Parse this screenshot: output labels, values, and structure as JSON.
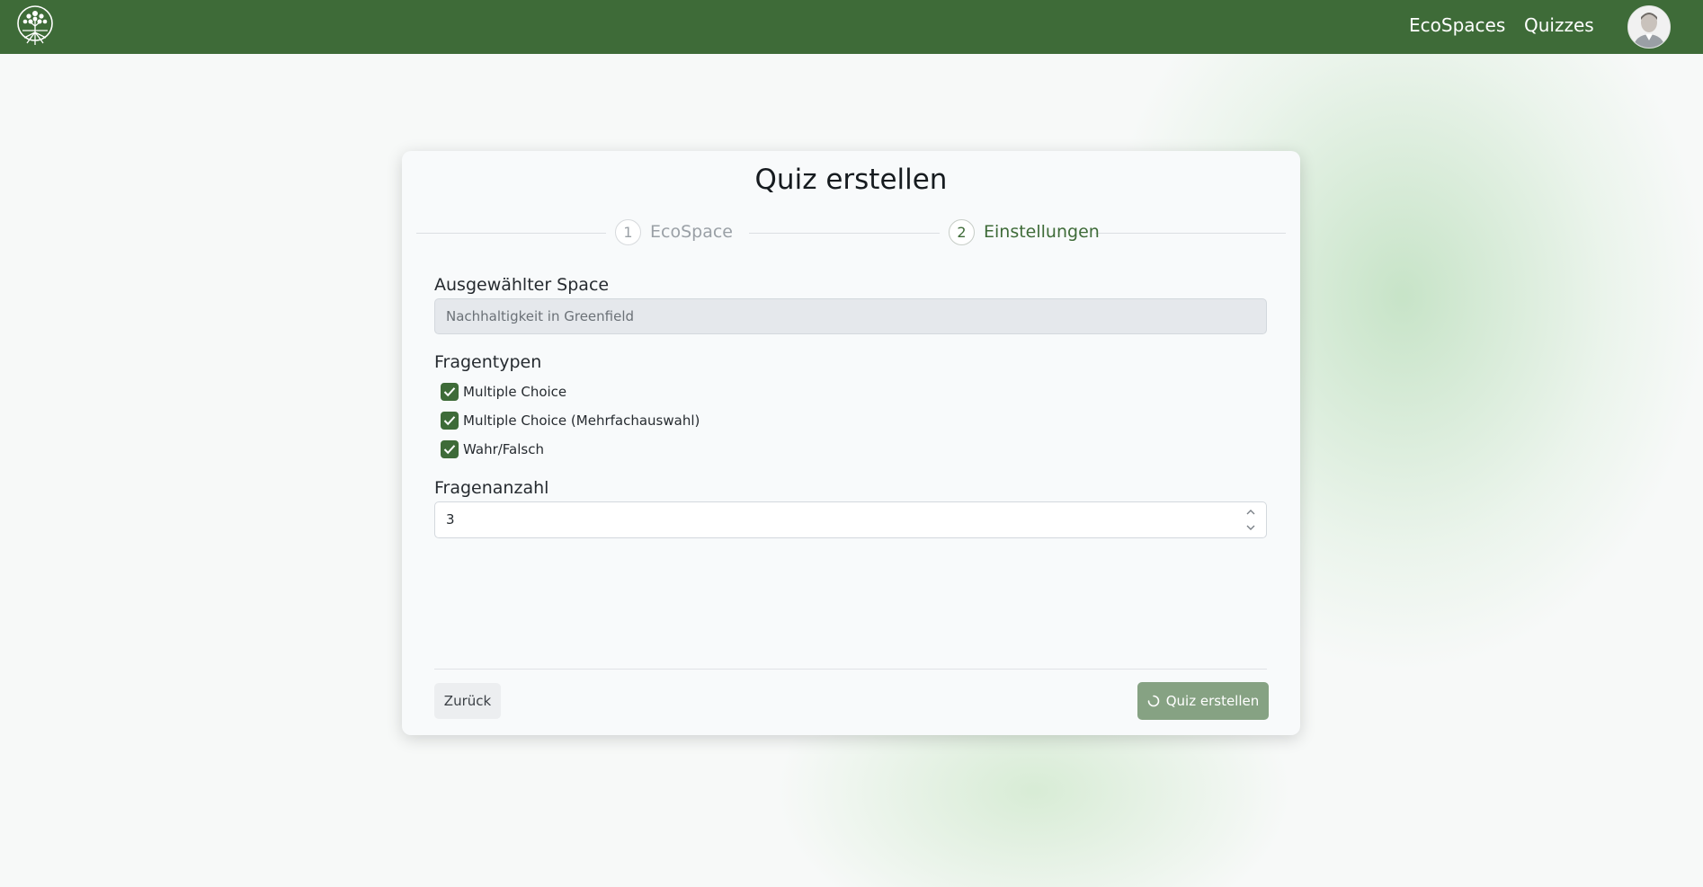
{
  "nav": {
    "links": [
      "EcoSpaces",
      "Quizzes"
    ]
  },
  "card": {
    "title": "Quiz erstellen",
    "steps": [
      {
        "number": "1",
        "label": "EcoSpace"
      },
      {
        "number": "2",
        "label": "Einstellungen"
      }
    ],
    "space_label": "Ausgewählter Space",
    "space_value": "Nachhaltigkeit in Greenfield",
    "question_types_label": "Fragentypen",
    "question_types": [
      {
        "label": "Multiple Choice",
        "checked": true
      },
      {
        "label": "Multiple Choice (Mehrfachauswahl)",
        "checked": true
      },
      {
        "label": "Wahr/Falsch",
        "checked": true
      }
    ],
    "count_label": "Fragenanzahl",
    "count_value": "3",
    "back_label": "Zurück",
    "create_label": "Quiz erstellen"
  },
  "colors": {
    "brand": "#3e6b38",
    "button_disabled": "#86a283"
  },
  "icons": [
    "tree-logo-icon",
    "user-avatar-icon",
    "checkmark-icon",
    "chevron-up-icon",
    "chevron-down-icon",
    "loading-spinner-icon"
  ]
}
